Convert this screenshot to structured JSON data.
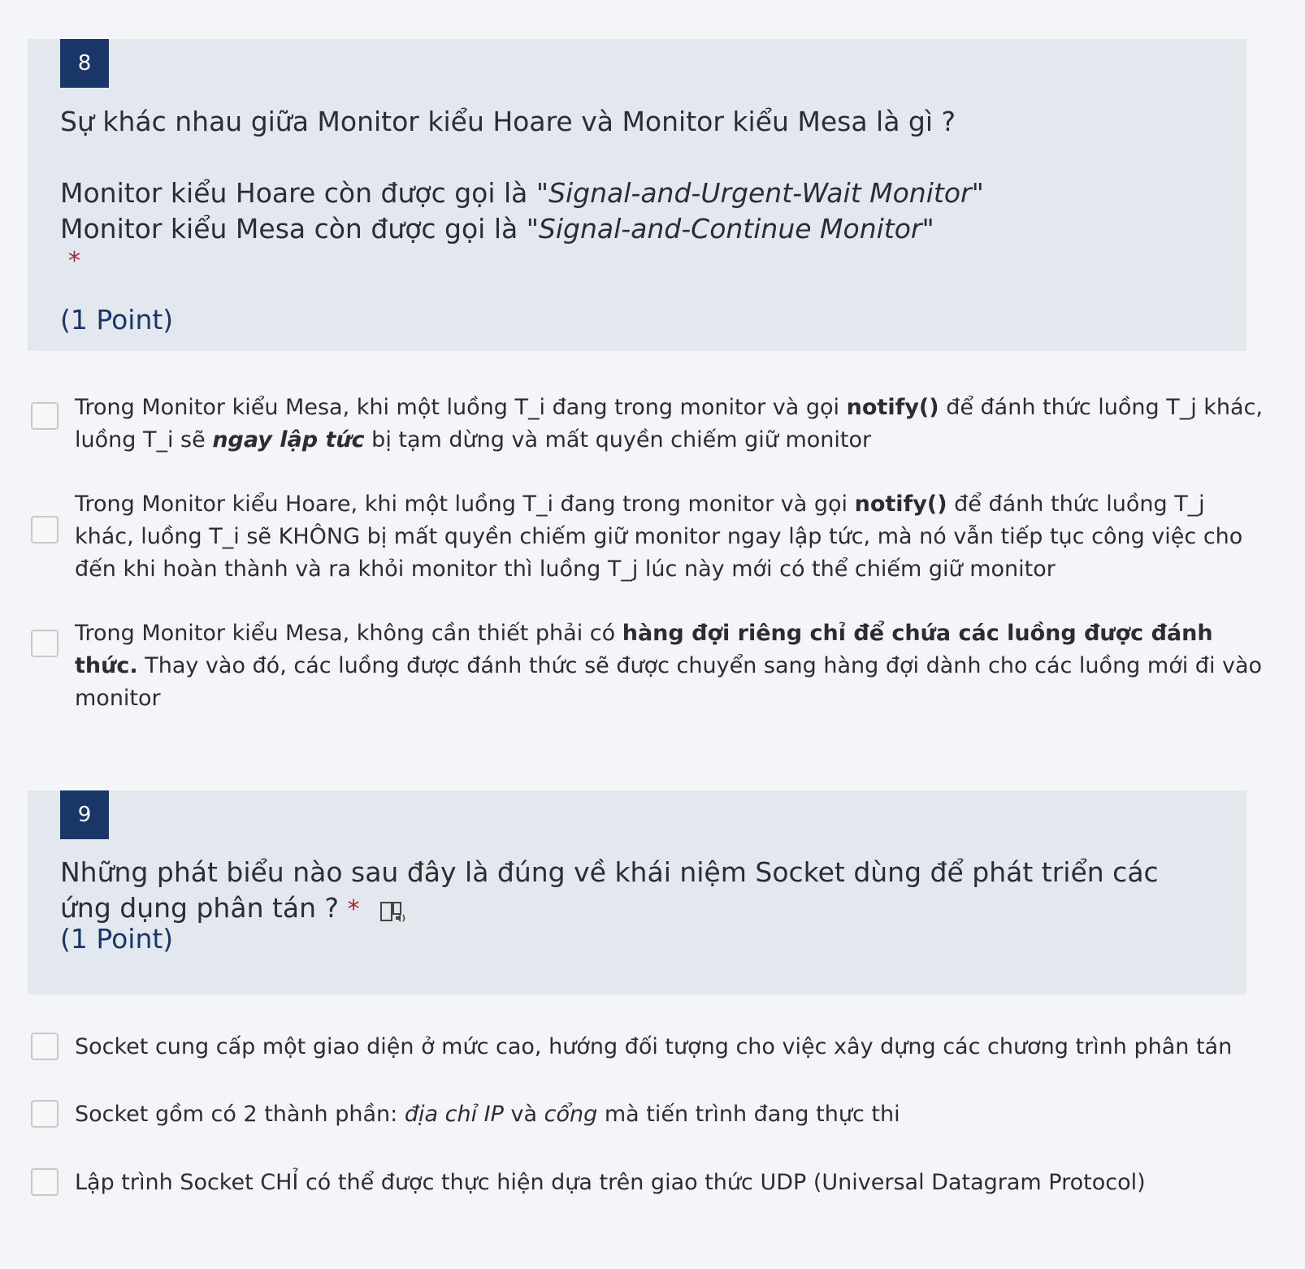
{
  "question8": {
    "number": "8",
    "title": "Sự khác nhau giữa Monitor kiểu Hoare và Monitor kiểu Mesa là gì ?",
    "subtitle_line1_prefix": "Monitor kiểu Hoare còn được gọi là \"",
    "subtitle_line1_italic": "Signal-and-Urgent-Wait Monitor",
    "subtitle_line1_suffix": "\"",
    "subtitle_line2_prefix": "Monitor kiểu Mesa còn được gọi là \"",
    "subtitle_line2_italic": "Signal-and-Continue Monitor",
    "subtitle_line2_suffix": "\"",
    "required_mark": "*",
    "points": "(1 Point)",
    "options": [
      {
        "t1": "Trong Monitor kiểu Mesa, khi một luồng T_i đang trong monitor và gọi ",
        "b1": "notify()",
        "t2": " để đánh thức luồng T_j khác, luồng T_i sẽ ",
        "bi": "ngay lập tức",
        "t3": " bị tạm dừng và mất quyền chiếm giữ monitor"
      },
      {
        "t1": "Trong Monitor kiểu Hoare, khi một luồng T_i đang trong monitor và gọi ",
        "b1": "notify()",
        "t2": " để đánh thức luồng T_j khác, luồng T_i sẽ KHÔNG bị mất quyền chiếm giữ monitor ngay lập tức, mà nó vẫn tiếp tục công việc cho đến khi hoàn thành và ra khỏi monitor thì luồng T_j lúc này mới có thể chiếm giữ monitor"
      },
      {
        "t1": "Trong Monitor kiểu Mesa, không cần thiết phải có ",
        "b1": "hàng đợi riêng chỉ để chứa các luồng được đánh thức.",
        "t2": " Thay vào đó, các luồng được đánh thức sẽ được chuyển sang hàng đợi dành cho các luồng mới đi vào monitor"
      }
    ]
  },
  "question9": {
    "number": "9",
    "title": "Những phát biểu nào sau đây là đúng về khái niệm Socket dùng để phát triển các ứng dụng phân tán ?",
    "required_mark": "*",
    "points": "(1 Point)",
    "options": [
      {
        "t1": "Socket cung cấp một giao diện ở mức cao, hướng đối tượng cho việc xây dựng các chương trình phân tán"
      },
      {
        "t1": "Socket gồm có 2 thành phần: ",
        "i1": "địa chỉ IP",
        "t2": " và ",
        "i2": "cổng",
        "t3": " mà tiến trình đang thực thi"
      },
      {
        "t1": "Lập trình Socket CHỈ có thể được thực hiện dựa trên giao thức UDP (Universal Datagram Protocol)"
      }
    ]
  },
  "colors": {
    "card_background": "#e3e7ee",
    "number_badge": "#1a3668",
    "required": "#a4262c",
    "points": "#1a3668"
  },
  "icons": {
    "immersive_reader": "immersive-reader-icon"
  }
}
